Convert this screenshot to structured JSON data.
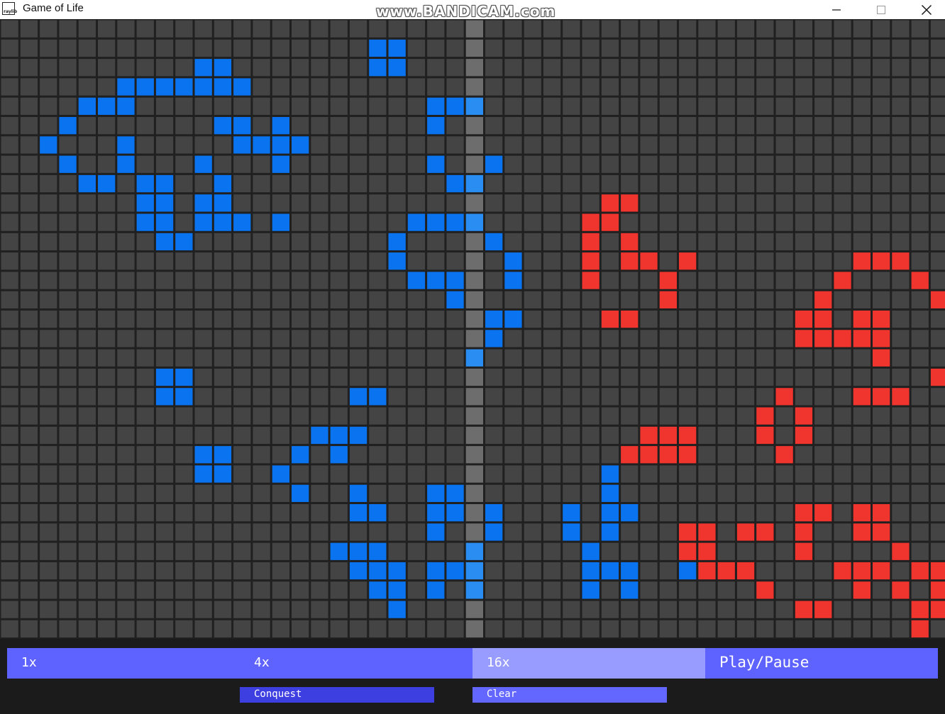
{
  "window": {
    "title": "Game of Life",
    "app_icon_text": "raylib",
    "watermark": "www.BANDICAM.com",
    "controls": [
      "minimize-icon",
      "maximize-icon",
      "close-icon"
    ]
  },
  "colors": {
    "empty_cell": "#444444",
    "grid_line": "#202020",
    "blue_cell": "#0a74f0",
    "red_cell": "#f0352f",
    "divider_column": "#6d6d6d",
    "divider_blue_cell": "#2a8df2",
    "button": "#5e63ff",
    "button_active": "#999cff",
    "button_conquest": "#3e3fe0"
  },
  "grid": {
    "columns": 49,
    "rows": 32,
    "divider_column_index": 24,
    "blue_cells": [
      [
        1,
        19
      ],
      [
        1,
        20
      ],
      [
        2,
        10
      ],
      [
        2,
        11
      ],
      [
        2,
        19
      ],
      [
        2,
        20
      ],
      [
        3,
        6
      ],
      [
        3,
        7
      ],
      [
        3,
        8
      ],
      [
        3,
        9
      ],
      [
        3,
        10
      ],
      [
        3,
        11
      ],
      [
        3,
        12
      ],
      [
        4,
        4
      ],
      [
        4,
        5
      ],
      [
        4,
        6
      ],
      [
        4,
        22
      ],
      [
        4,
        23
      ],
      [
        4,
        24
      ],
      [
        5,
        3
      ],
      [
        5,
        11
      ],
      [
        5,
        12
      ],
      [
        5,
        14
      ],
      [
        5,
        22
      ],
      [
        6,
        2
      ],
      [
        6,
        6
      ],
      [
        6,
        12
      ],
      [
        6,
        13
      ],
      [
        6,
        14
      ],
      [
        6,
        15
      ],
      [
        7,
        3
      ],
      [
        7,
        6
      ],
      [
        7,
        10
      ],
      [
        7,
        14
      ],
      [
        7,
        22
      ],
      [
        7,
        25
      ],
      [
        8,
        4
      ],
      [
        8,
        5
      ],
      [
        8,
        7
      ],
      [
        8,
        8
      ],
      [
        8,
        11
      ],
      [
        8,
        23
      ],
      [
        8,
        24
      ],
      [
        9,
        7
      ],
      [
        9,
        8
      ],
      [
        9,
        10
      ],
      [
        9,
        11
      ],
      [
        10,
        7
      ],
      [
        10,
        8
      ],
      [
        10,
        10
      ],
      [
        10,
        11
      ],
      [
        10,
        12
      ],
      [
        10,
        14
      ],
      [
        10,
        21
      ],
      [
        10,
        22
      ],
      [
        10,
        23
      ],
      [
        10,
        24
      ],
      [
        11,
        8
      ],
      [
        11,
        9
      ],
      [
        11,
        20
      ],
      [
        11,
        25
      ],
      [
        12,
        20
      ],
      [
        12,
        26
      ],
      [
        13,
        21
      ],
      [
        13,
        22
      ],
      [
        13,
        23
      ],
      [
        13,
        26
      ],
      [
        14,
        23
      ],
      [
        15,
        25
      ],
      [
        15,
        26
      ],
      [
        16,
        25
      ],
      [
        17,
        24
      ],
      [
        18,
        8
      ],
      [
        18,
        9
      ],
      [
        19,
        8
      ],
      [
        19,
        9
      ],
      [
        19,
        18
      ],
      [
        19,
        19
      ],
      [
        21,
        16
      ],
      [
        21,
        17
      ],
      [
        21,
        18
      ],
      [
        22,
        10
      ],
      [
        22,
        11
      ],
      [
        22,
        15
      ],
      [
        22,
        17
      ],
      [
        23,
        10
      ],
      [
        23,
        11
      ],
      [
        23,
        14
      ],
      [
        23,
        31
      ],
      [
        24,
        15
      ],
      [
        24,
        18
      ],
      [
        24,
        22
      ],
      [
        24,
        23
      ],
      [
        24,
        31
      ],
      [
        25,
        18
      ],
      [
        25,
        19
      ],
      [
        25,
        22
      ],
      [
        25,
        23
      ],
      [
        25,
        25
      ],
      [
        25,
        29
      ],
      [
        25,
        31
      ],
      [
        25,
        32
      ],
      [
        26,
        22
      ],
      [
        26,
        25
      ],
      [
        26,
        29
      ],
      [
        26,
        31
      ],
      [
        27,
        17
      ],
      [
        27,
        18
      ],
      [
        27,
        19
      ],
      [
        27,
        24
      ],
      [
        27,
        30
      ],
      [
        28,
        18
      ],
      [
        28,
        19
      ],
      [
        28,
        20
      ],
      [
        28,
        22
      ],
      [
        28,
        23
      ],
      [
        28,
        24
      ],
      [
        28,
        30
      ],
      [
        28,
        31
      ],
      [
        28,
        32
      ],
      [
        28,
        35
      ],
      [
        29,
        19
      ],
      [
        29,
        20
      ],
      [
        29,
        22
      ],
      [
        29,
        24
      ],
      [
        29,
        30
      ],
      [
        29,
        32
      ],
      [
        30,
        20
      ]
    ],
    "red_cells": [
      [
        9,
        31
      ],
      [
        9,
        32
      ],
      [
        10,
        30
      ],
      [
        10,
        31
      ],
      [
        11,
        30
      ],
      [
        11,
        32
      ],
      [
        12,
        30
      ],
      [
        12,
        32
      ],
      [
        12,
        33
      ],
      [
        12,
        35
      ],
      [
        12,
        44
      ],
      [
        12,
        45
      ],
      [
        12,
        46
      ],
      [
        13,
        30
      ],
      [
        13,
        34
      ],
      [
        13,
        43
      ],
      [
        13,
        47
      ],
      [
        14,
        34
      ],
      [
        14,
        42
      ],
      [
        14,
        48
      ],
      [
        15,
        31
      ],
      [
        15,
        32
      ],
      [
        15,
        41
      ],
      [
        15,
        42
      ],
      [
        15,
        44
      ],
      [
        15,
        45
      ],
      [
        16,
        41
      ],
      [
        16,
        42
      ],
      [
        16,
        43
      ],
      [
        16,
        44
      ],
      [
        16,
        45
      ],
      [
        17,
        45
      ],
      [
        18,
        48
      ],
      [
        19,
        40
      ],
      [
        19,
        44
      ],
      [
        19,
        45
      ],
      [
        19,
        46
      ],
      [
        20,
        39
      ],
      [
        20,
        41
      ],
      [
        21,
        33
      ],
      [
        21,
        34
      ],
      [
        21,
        35
      ],
      [
        21,
        39
      ],
      [
        21,
        41
      ],
      [
        22,
        32
      ],
      [
        22,
        33
      ],
      [
        22,
        34
      ],
      [
        22,
        35
      ],
      [
        22,
        40
      ],
      [
        25,
        41
      ],
      [
        25,
        42
      ],
      [
        25,
        44
      ],
      [
        25,
        45
      ],
      [
        26,
        35
      ],
      [
        26,
        36
      ],
      [
        26,
        38
      ],
      [
        26,
        39
      ],
      [
        26,
        41
      ],
      [
        26,
        44
      ],
      [
        26,
        45
      ],
      [
        27,
        35
      ],
      [
        27,
        36
      ],
      [
        27,
        41
      ],
      [
        27,
        46
      ],
      [
        28,
        36
      ],
      [
        28,
        37
      ],
      [
        28,
        38
      ],
      [
        28,
        43
      ],
      [
        28,
        44
      ],
      [
        28,
        45
      ],
      [
        28,
        47
      ],
      [
        28,
        48
      ],
      [
        29,
        39
      ],
      [
        29,
        44
      ],
      [
        29,
        46
      ],
      [
        29,
        48
      ],
      [
        30,
        41
      ],
      [
        30,
        42
      ],
      [
        30,
        47
      ],
      [
        30,
        48
      ],
      [
        31,
        47
      ]
    ]
  },
  "controls": {
    "speed_1x": "1x",
    "speed_4x": "4x",
    "speed_16x": "16x",
    "play_pause": "Play/Pause",
    "conquest": "Conquest",
    "clear": "Clear",
    "active_speed": "16x"
  }
}
